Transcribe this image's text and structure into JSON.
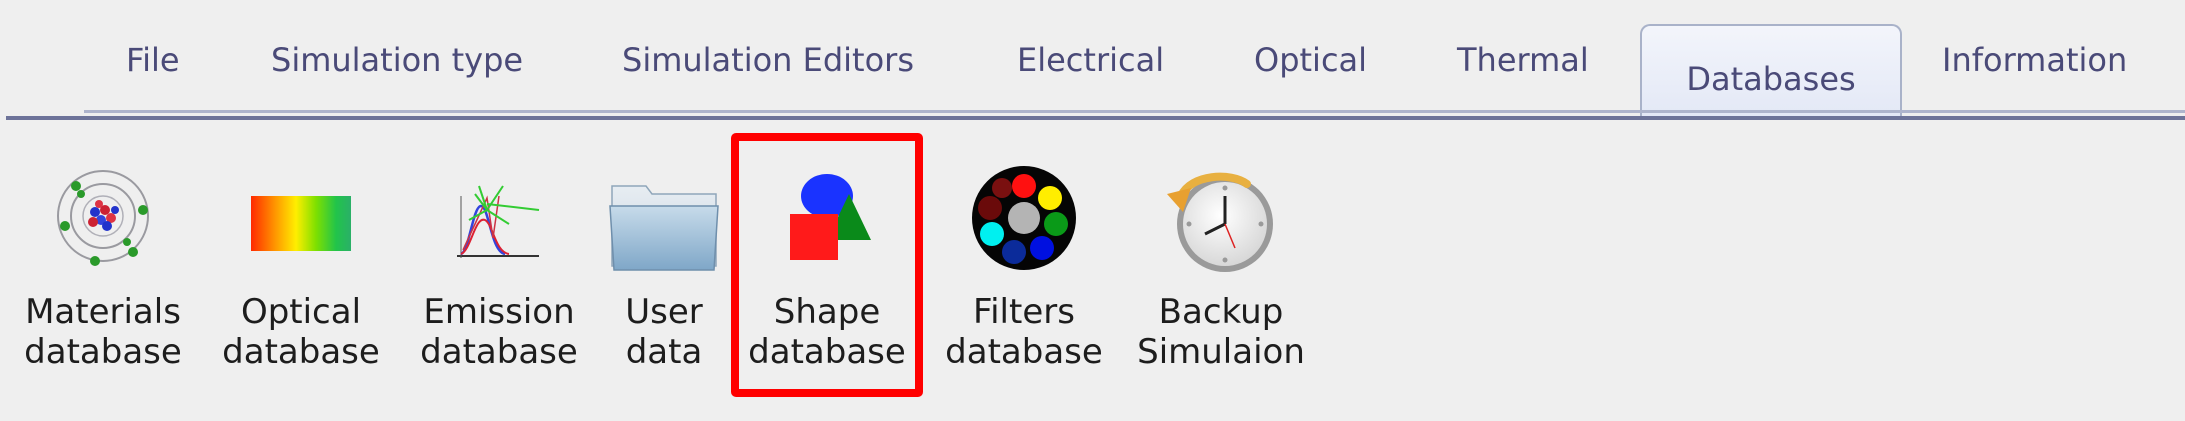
{
  "tabs": {
    "file": "File",
    "simulation_type": "Simulation type",
    "simulation_editors": "Simulation Editors",
    "electrical": "Electrical",
    "optical": "Optical",
    "thermal": "Thermal",
    "databases": "Databases",
    "information": "Information"
  },
  "active_tab": "Databases",
  "toolbar": {
    "materials": {
      "line1": "Materials",
      "line2": "database",
      "icon": "atom-icon"
    },
    "optical": {
      "line1": "Optical",
      "line2": "database",
      "icon": "spectrum-icon"
    },
    "emission": {
      "line1": "Emission",
      "line2": "database",
      "icon": "emission-spectrum-icon"
    },
    "user_data": {
      "line1": "User",
      "line2": "data",
      "icon": "folder-icon"
    },
    "shape": {
      "line1": "Shape",
      "line2": "database",
      "icon": "shapes-icon"
    },
    "filters": {
      "line1": "Filters",
      "line2": "database",
      "icon": "color-filter-wheel-icon"
    },
    "backup": {
      "line1": "Backup",
      "line2": "Simulaion",
      "icon": "clock-restore-icon"
    }
  },
  "highlighted_item": "shape",
  "colors": {
    "tab_text": "#4a4a78",
    "highlight": "#ff0000",
    "background": "#efefef"
  }
}
